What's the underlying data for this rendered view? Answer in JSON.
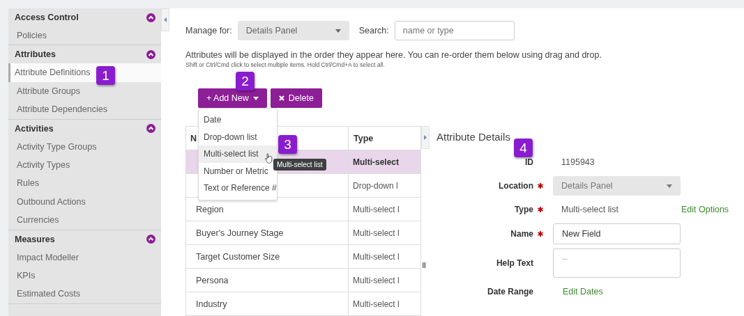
{
  "sidebar": {
    "sections": [
      {
        "title": "Access Control",
        "expanded": true,
        "items": [
          {
            "label": "Policies",
            "selected": false
          }
        ]
      },
      {
        "title": "Attributes",
        "expanded": true,
        "items": [
          {
            "label": "Attribute Definitions",
            "selected": true
          },
          {
            "label": "Attribute Groups",
            "selected": false
          },
          {
            "label": "Attribute Dependencies",
            "selected": false
          }
        ]
      },
      {
        "title": "Activities",
        "expanded": true,
        "items": [
          {
            "label": "Activity Type Groups",
            "selected": false
          },
          {
            "label": "Activity Types",
            "selected": false
          },
          {
            "label": "Rules",
            "selected": false
          },
          {
            "label": "Outbound Actions",
            "selected": false
          },
          {
            "label": "Currencies",
            "selected": false
          }
        ]
      },
      {
        "title": "Measures",
        "expanded": true,
        "items": [
          {
            "label": "Impact Modeller",
            "selected": false
          },
          {
            "label": "KPIs",
            "selected": false
          },
          {
            "label": "Estimated Costs",
            "selected": false
          }
        ]
      }
    ]
  },
  "toolbar": {
    "manage_label": "Manage for:",
    "manage_value": "Details Panel",
    "search_label": "Search:",
    "search_placeholder": "name or type"
  },
  "intro": "Attributes will be displayed in the order they appear here. You can re-order them below using drag and drop.",
  "hint": "Shift or Ctrl/Cmd click to select multiple items. Hold Ctrl/Cmd+A to select all.",
  "buttons": {
    "add": "+ Add New",
    "delete": "Delete"
  },
  "add_menu": {
    "items": [
      {
        "label": "Date",
        "selected": false
      },
      {
        "label": "Drop-down list",
        "selected": false
      },
      {
        "label": "Multi-select list",
        "selected": true
      },
      {
        "label": "Number or Metric",
        "selected": false
      },
      {
        "label": "Text or Reference #",
        "selected": false
      }
    ],
    "tooltip": "Multi-select list"
  },
  "table": {
    "columns": [
      "N",
      "Type"
    ],
    "rows": [
      {
        "type": "Multi-select",
        "selected": true
      },
      {
        "type": "Drop-down l",
        "selected": false
      },
      {
        "name": "Region",
        "type": "Multi-select l",
        "selected": false
      },
      {
        "name": "Buyer's Journey Stage",
        "type": "Multi-select l",
        "selected": false
      },
      {
        "name": "Target Customer Size",
        "type": "Multi-select l",
        "selected": false
      },
      {
        "name": "Persona",
        "type": "Multi-select l",
        "selected": false
      },
      {
        "name": "Industry",
        "type": "Multi-select l",
        "selected": false
      }
    ]
  },
  "splitter": "III",
  "details": {
    "title": "Attribute Details",
    "fields": [
      {
        "kind": "text",
        "label": "ID",
        "required": false,
        "value": "1195943"
      },
      {
        "kind": "select",
        "label": "Location",
        "required": true,
        "value": "Details Panel"
      },
      {
        "kind": "text",
        "label": "Type",
        "required": true,
        "value": "Multi-select list",
        "link": "Edit Options"
      },
      {
        "kind": "input",
        "label": "Name",
        "required": true,
        "value": "New Field"
      },
      {
        "kind": "textarea",
        "label": "Help Text",
        "required": false,
        "placeholder": "..."
      },
      {
        "kind": "link",
        "label": "Date Range",
        "required": false,
        "link": "Edit Dates"
      }
    ]
  },
  "callouts": [
    "1",
    "2",
    "3",
    "4"
  ]
}
